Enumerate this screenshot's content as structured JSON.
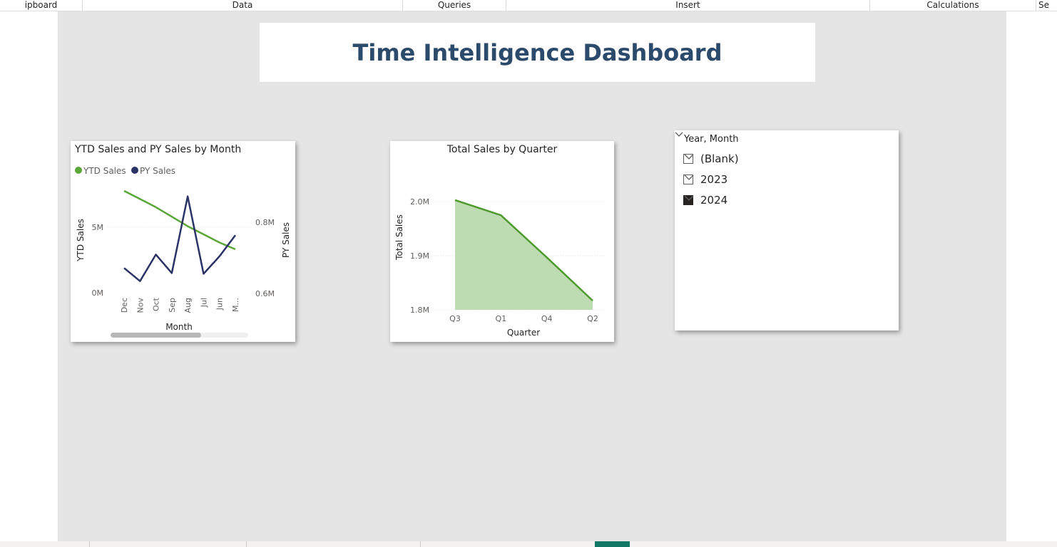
{
  "ribbon": {
    "groups": [
      "ipboard",
      "Data",
      "Queries",
      "Insert",
      "Calculations",
      "Se"
    ]
  },
  "report_title": "Time Intelligence Dashboard",
  "colors": {
    "ytd": "#5aa637",
    "py": "#2b3366",
    "area_fill": "#bedcb1",
    "area_line": "#4e9a2f",
    "active_tab": "#117865"
  },
  "slicer": {
    "header": "Year, Month",
    "items": [
      {
        "label": "(Blank)",
        "checked": false
      },
      {
        "label": "2023",
        "checked": false
      },
      {
        "label": "2024",
        "checked": true
      }
    ]
  },
  "chart_data": [
    {
      "type": "line",
      "title": "YTD Sales and PY Sales by Month",
      "xlabel": "Month",
      "ylabel": "YTD Sales",
      "y2label": "PY Sales",
      "categories": [
        "Dec",
        "Nov",
        "Oct",
        "Sep",
        "Aug",
        "Jul",
        "Jun",
        "M..."
      ],
      "y_ticks": [
        "0M",
        "5M"
      ],
      "y2_ticks": [
        "0.6M",
        "0.8M"
      ],
      "ylim": [
        0,
        7.5
      ],
      "y2lim": [
        0.6,
        0.88
      ],
      "legend": "top-left",
      "series": [
        {
          "name": "YTD Sales",
          "axis": "left",
          "values": [
            7.5,
            6.9,
            6.3,
            5.6,
            4.9,
            4.3,
            3.7,
            3.2
          ]
        },
        {
          "name": "PY Sales",
          "axis": "left-secondary",
          "values": [
            0.668,
            0.632,
            0.705,
            0.654,
            0.865,
            0.652,
            0.7,
            0.758
          ]
        }
      ]
    },
    {
      "type": "area",
      "title": "Total Sales by Quarter",
      "xlabel": "Quarter",
      "ylabel": "Total Sales",
      "categories": [
        "Q3",
        "Q1",
        "Q4",
        "Q2"
      ],
      "y_ticks": [
        "1.8M",
        "1.9M",
        "2.0M"
      ],
      "ylim": [
        1.8,
        2.02
      ],
      "values": [
        2.003,
        1.975,
        1.897,
        1.817
      ]
    }
  ]
}
